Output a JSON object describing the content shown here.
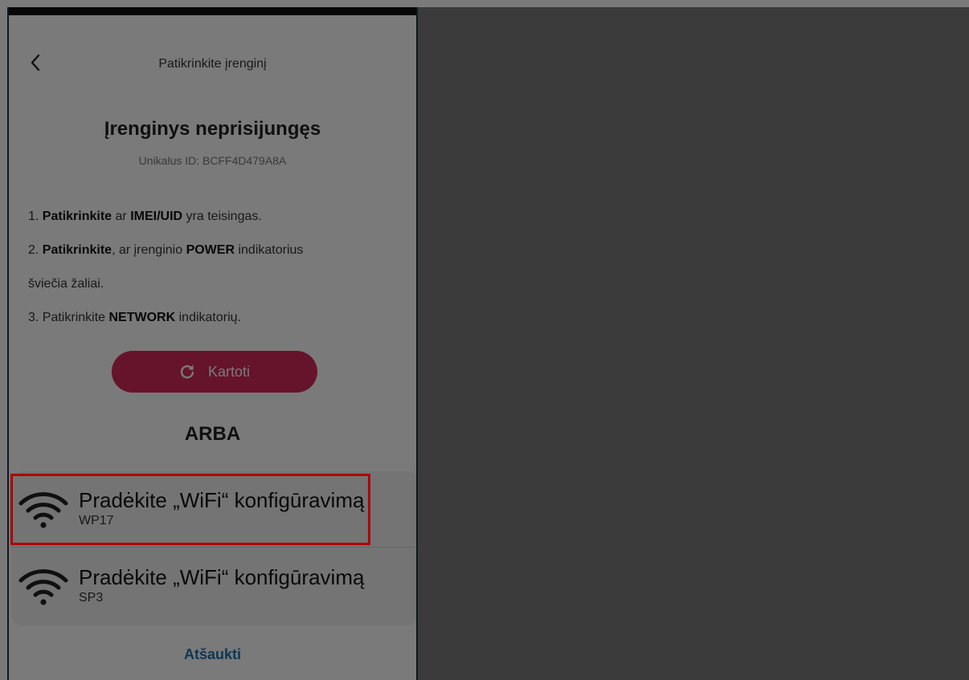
{
  "header": {
    "title": "Patikrinkite įrenginį"
  },
  "status": {
    "title": "Įrenginys neprisijungęs",
    "uid": "Unikalus ID: BCFF4D479A8A"
  },
  "instructions": {
    "line1": {
      "bold1": "Patikrinkite",
      "text1": "ar",
      "bold2": "IMEI/UID",
      "text2": "yra teisingas.",
      "prefix": "1."
    },
    "line2": {
      "prefix": "2.",
      "bold1": "Patikrinkite",
      "text1": ", ar įrenginio",
      "bold2": "POWER",
      "text2": "indikatorius"
    },
    "line3": {
      "text": "šviečia žaliai."
    },
    "line4": {
      "prefix": "3. Patikrinkite",
      "bold": "NETWORK",
      "text": "indikatorių."
    }
  },
  "retry": {
    "label": "Kartoti",
    "icon": "refresh-icon"
  },
  "separator": "ARBA",
  "options": [
    {
      "title": "Pradėkite „WiFi“ konfigūravimą",
      "subtitle": "WP17",
      "icon": "wifi-icon"
    },
    {
      "title": "Pradėkite „WiFi“ konfigūravimą",
      "subtitle": "SP3",
      "icon": "wifi-icon"
    }
  ],
  "cancel": "Atšaukti",
  "colors": {
    "accent": "#d42a5a",
    "link": "#1b73b3",
    "highlight": "#b00000"
  }
}
